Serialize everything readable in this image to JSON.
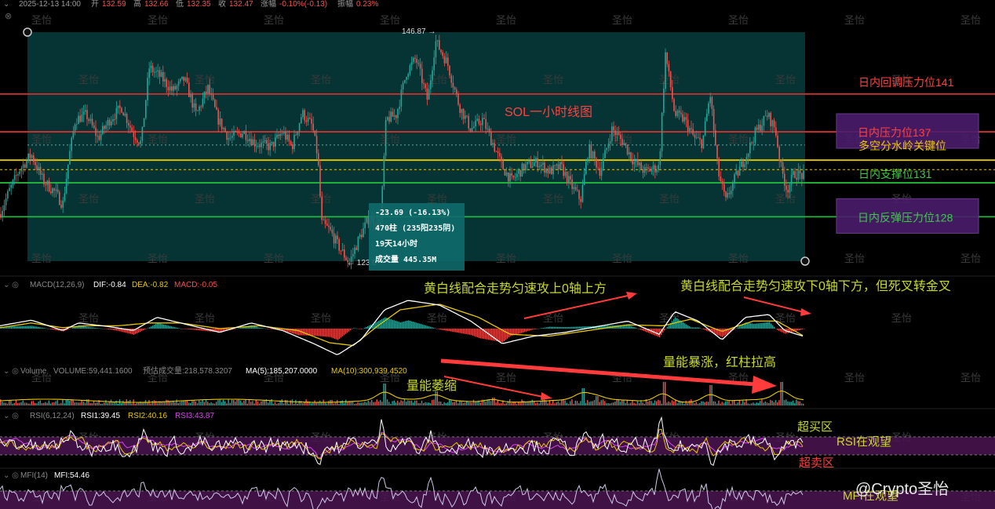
{
  "header": {
    "date": "2025-12-13 14:00",
    "open_label": "开",
    "open": "132.59",
    "high_label": "高",
    "high": "132.66",
    "low_label": "低",
    "low": "132.35",
    "close_label": "收",
    "close": "132.47",
    "change_label": "涨幅",
    "change": "-0.10%(-0.13)",
    "amp_label": "振幅",
    "amp": "0.23%"
  },
  "colors": {
    "up": "#26a69a",
    "down": "#ef5350",
    "red_line": "#d32f2f",
    "yellow_line": "#e8c800",
    "green_line": "#22b83c",
    "dif": "#ffffff",
    "dea": "#e8c800",
    "annotation_yellow": "#c9d92b",
    "annotation_red": "#ff3b3b",
    "purple_box": "#4a1d6b",
    "rsi_band": "#4a1450"
  },
  "chart_data": {
    "type": "candlestick",
    "title": "SOL一小时线图",
    "price_range": [
      122.5,
      149.5
    ],
    "measure": {
      "top_price": "146.87",
      "bottom_price": "123.0",
      "change": "-23.69 (-16.13%)",
      "bars": "470柱 (235阳235阴)",
      "duration": "19天14小时",
      "volume": "成交量 445.35M"
    },
    "levels": [
      {
        "label": "日内回调压力位141",
        "value": 141.2,
        "color": "red",
        "boxed": false
      },
      {
        "label": "日内压力位137",
        "value": 137.2,
        "color": "red",
        "boxed": true
      },
      {
        "label": "多空分水岭关键位",
        "value": 134.2,
        "color": "yellow",
        "boxed": false
      },
      {
        "label": "日内支撑位131",
        "value": 131.8,
        "color": "green",
        "boxed": false
      },
      {
        "label": "日内反弹压力位128",
        "value": 128.2,
        "color": "green",
        "boxed": true
      }
    ],
    "price_path": [
      [
        0,
        128.5
      ],
      [
        12,
        131.0
      ],
      [
        25,
        133.2
      ],
      [
        40,
        134.8
      ],
      [
        55,
        132.0
      ],
      [
        70,
        130.8
      ],
      [
        80,
        129.5
      ],
      [
        88,
        134.5
      ],
      [
        96,
        138.5
      ],
      [
        110,
        139.0
      ],
      [
        125,
        136.5
      ],
      [
        140,
        138.5
      ],
      [
        155,
        139.8
      ],
      [
        170,
        137.0
      ],
      [
        180,
        136.0
      ],
      [
        190,
        144.0
      ],
      [
        205,
        143.0
      ],
      [
        220,
        141.5
      ],
      [
        235,
        142.8
      ],
      [
        250,
        139.0
      ],
      [
        265,
        141.8
      ],
      [
        278,
        138.5
      ],
      [
        292,
        136.5
      ],
      [
        310,
        137.2
      ],
      [
        325,
        136.0
      ],
      [
        345,
        135.6
      ],
      [
        360,
        137.2
      ],
      [
        372,
        135.6
      ],
      [
        385,
        139.2
      ],
      [
        398,
        137.8
      ],
      [
        405,
        134.5
      ],
      [
        410,
        127.5
      ],
      [
        420,
        126.8
      ],
      [
        432,
        125.0
      ],
      [
        445,
        123.3
      ],
      [
        458,
        126.0
      ],
      [
        470,
        128.0
      ],
      [
        485,
        127.5
      ],
      [
        492,
        138.5
      ],
      [
        505,
        139.0
      ],
      [
        518,
        143.5
      ],
      [
        530,
        145.0
      ],
      [
        545,
        140.5
      ],
      [
        555,
        146.8
      ],
      [
        570,
        144.5
      ],
      [
        585,
        140.0
      ],
      [
        600,
        137.5
      ],
      [
        615,
        138.5
      ],
      [
        628,
        136.0
      ],
      [
        640,
        133.5
      ],
      [
        652,
        132.0
      ],
      [
        668,
        133.5
      ],
      [
        685,
        134.0
      ],
      [
        700,
        133.0
      ],
      [
        715,
        133.5
      ],
      [
        728,
        131.5
      ],
      [
        740,
        130.0
      ],
      [
        750,
        135.5
      ],
      [
        765,
        133.0
      ],
      [
        780,
        137.5
      ],
      [
        795,
        136.0
      ],
      [
        808,
        134.0
      ],
      [
        822,
        133.0
      ],
      [
        840,
        133.5
      ],
      [
        848,
        145.5
      ],
      [
        860,
        139.0
      ],
      [
        872,
        138.5
      ],
      [
        885,
        136.5
      ],
      [
        895,
        136.0
      ],
      [
        905,
        141.2
      ],
      [
        915,
        133.0
      ],
      [
        925,
        129.8
      ],
      [
        935,
        132.0
      ],
      [
        950,
        134.5
      ],
      [
        962,
        137.0
      ],
      [
        978,
        139.0
      ],
      [
        988,
        137.5
      ],
      [
        995,
        133.5
      ],
      [
        1003,
        131.0
      ],
      [
        1012,
        132.8
      ],
      [
        1025,
        132.5
      ]
    ],
    "macd": {
      "label": "MACD(12,26,9)",
      "dif_label": "DIF:-0.84",
      "dea_label": "DEA:-0.82",
      "macd_label": "MACD:-0.05",
      "dif": [
        [
          0,
          0.3
        ],
        [
          40,
          0.9
        ],
        [
          80,
          -0.2
        ],
        [
          100,
          0.6
        ],
        [
          140,
          0.2
        ],
        [
          170,
          -0.2
        ],
        [
          200,
          1.2
        ],
        [
          240,
          0.4
        ],
        [
          280,
          -0.4
        ],
        [
          320,
          0.6
        ],
        [
          360,
          -0.2
        ],
        [
          400,
          -1.6
        ],
        [
          430,
          -2.8
        ],
        [
          460,
          -1.2
        ],
        [
          490,
          2.0
        ],
        [
          520,
          3.0
        ],
        [
          560,
          2.5
        ],
        [
          600,
          0.8
        ],
        [
          640,
          -1.6
        ],
        [
          680,
          -0.8
        ],
        [
          720,
          -0.4
        ],
        [
          760,
          0.2
        ],
        [
          800,
          0.8
        ],
        [
          840,
          -0.6
        ],
        [
          860,
          1.8
        ],
        [
          890,
          0.8
        ],
        [
          920,
          -1.2
        ],
        [
          950,
          1.2
        ],
        [
          980,
          1.5
        ],
        [
          1000,
          -0.2
        ],
        [
          1025,
          -0.84
        ]
      ],
      "dea": [
        [
          0,
          0.1
        ],
        [
          40,
          0.6
        ],
        [
          80,
          0.1
        ],
        [
          110,
          0.3
        ],
        [
          150,
          0.3
        ],
        [
          190,
          0.6
        ],
        [
          230,
          0.6
        ],
        [
          280,
          0.0
        ],
        [
          330,
          0.3
        ],
        [
          380,
          -0.2
        ],
        [
          420,
          -1.5
        ],
        [
          450,
          -1.8
        ],
        [
          480,
          0.2
        ],
        [
          510,
          2.0
        ],
        [
          560,
          2.6
        ],
        [
          610,
          1.2
        ],
        [
          650,
          -0.6
        ],
        [
          700,
          -0.8
        ],
        [
          750,
          -0.2
        ],
        [
          800,
          0.4
        ],
        [
          845,
          0.3
        ],
        [
          880,
          1.0
        ],
        [
          920,
          -0.3
        ],
        [
          960,
          0.8
        ],
        [
          990,
          0.8
        ],
        [
          1025,
          -0.82
        ]
      ]
    },
    "volume": {
      "label": "Volume",
      "vol_label": "VOLUME:59,441.1600",
      "est_label": "预估成交量:218,578.3207",
      "ma5_label": "MA(5):185,207.0000",
      "ma10_label": "MA(10):300,939.4520"
    },
    "rsi": {
      "label": "RSI(6,12,24)",
      "rsi1": "RSI1:39.45",
      "rsi2": "RSI2:40.16",
      "rsi3": "RSI3:43.87"
    },
    "mfi": {
      "label": "MFI(14)",
      "mfi": "MFI:54.46"
    }
  },
  "annotations": {
    "macd_left": "黄白线配合走势匀速攻上0轴上方",
    "macd_right": "黄白线配合走势匀速攻下0轴下方，但死叉转金叉",
    "vol_shrink": "量能萎缩",
    "vol_burst": "量能暴涨，红柱拉高",
    "overbought": "超买区",
    "rsi_watch": "RSI在观望",
    "oversold": "超卖区",
    "mfi_watch": "MFI在观望",
    "watermark": "圣怡",
    "brand": "@Crypto圣怡"
  }
}
